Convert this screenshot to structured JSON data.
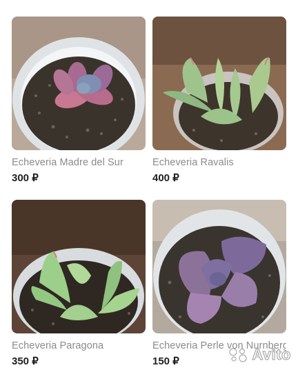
{
  "listings": [
    {
      "name": "Echeveria Madre del Sur",
      "price": "300",
      "currency": "₽",
      "icon": "succulent-rosette-pink"
    },
    {
      "name": "Echeveria Ravalis",
      "price": "400",
      "currency": "₽",
      "icon": "succulent-rosette-green"
    },
    {
      "name": "Echeveria Paragona",
      "price": "350",
      "currency": "₽",
      "icon": "succulent-rosette-green"
    },
    {
      "name": "Echeveria Perle von Nurnberg",
      "price": "150",
      "currency": "₽",
      "icon": "succulent-rosette-purple"
    }
  ],
  "watermark": {
    "text": "Avito"
  },
  "colors": {
    "price": "#1f1f1f",
    "name": "#8a8a8a"
  }
}
